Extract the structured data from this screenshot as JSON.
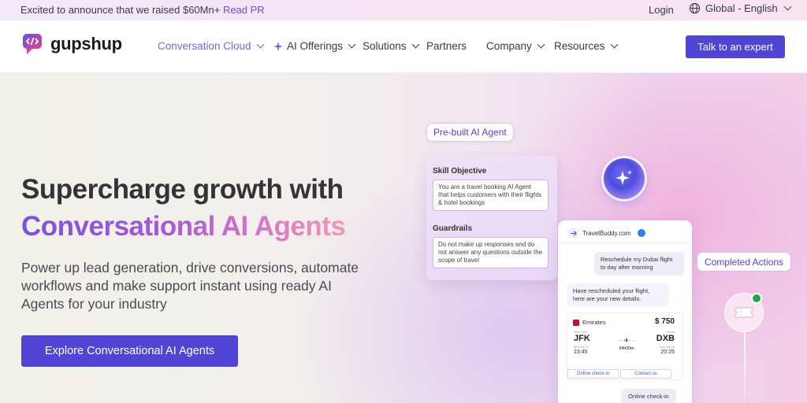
{
  "topbar": {
    "announce_text": "Excited to announce that we raised $60Mn+",
    "announce_link": "Read PR",
    "login": "Login",
    "language": "Global - English"
  },
  "nav": {
    "logo_text": "gupshup",
    "menu": [
      {
        "label": "Conversation Cloud",
        "active": true,
        "dropdown": true
      },
      {
        "label": "AI Offerings",
        "active": false,
        "dropdown": true
      },
      {
        "label": "Solutions",
        "active": false,
        "dropdown": true
      },
      {
        "label": "Partners",
        "active": false,
        "dropdown": false
      },
      {
        "label": "Company",
        "active": false,
        "dropdown": true
      },
      {
        "label": "Resources",
        "active": false,
        "dropdown": true
      }
    ],
    "cta": "Talk to an expert"
  },
  "hero": {
    "title_line1": "Supercharge growth with",
    "title_line2": "Conversational AI Agents",
    "subtitle": "Power up lead generation, drive conversions, automate workflows and make support instant using ready AI Agents for your industry",
    "cta": "Explore Conversational AI Agents"
  },
  "illustration": {
    "prebuilt_label": "Pre-built AI Agent",
    "skill_label": "Skill Objective",
    "skill_text": "You are a travel booking AI Agent that helps customers with their flights & hotel bookings",
    "guardrails_label": "Guardrails",
    "guardrails_text": "Do not make up responses and do not answer any questions outside the scope of travel",
    "chat_name": "TravelBuddy.com",
    "msg_user": "Reschedule my Dubai flight to day after morning",
    "msg_bot": "Have rescheduled your flight, here are your new details.",
    "ticket": {
      "airline": "Emirates",
      "price": "$ 750",
      "from_city": "New York",
      "from": "JFK",
      "from_date": "Mon 05 Fri",
      "from_time": "23:45",
      "duration": "04h20m",
      "to_city": "Dubai",
      "to": "DXB",
      "to_date": "Mon 06 Fri",
      "to_time": "20:25",
      "btn_checkin": "Online check-in",
      "btn_contact": "Contact us"
    },
    "msg_user2": "Online check-in",
    "completed_label": "Completed Actions"
  },
  "colors": {
    "accent": "#4f46d6",
    "active_menu": "#7b62d9",
    "gradient_start": "#7c4fe0",
    "gradient_end": "#ee9ab7"
  }
}
